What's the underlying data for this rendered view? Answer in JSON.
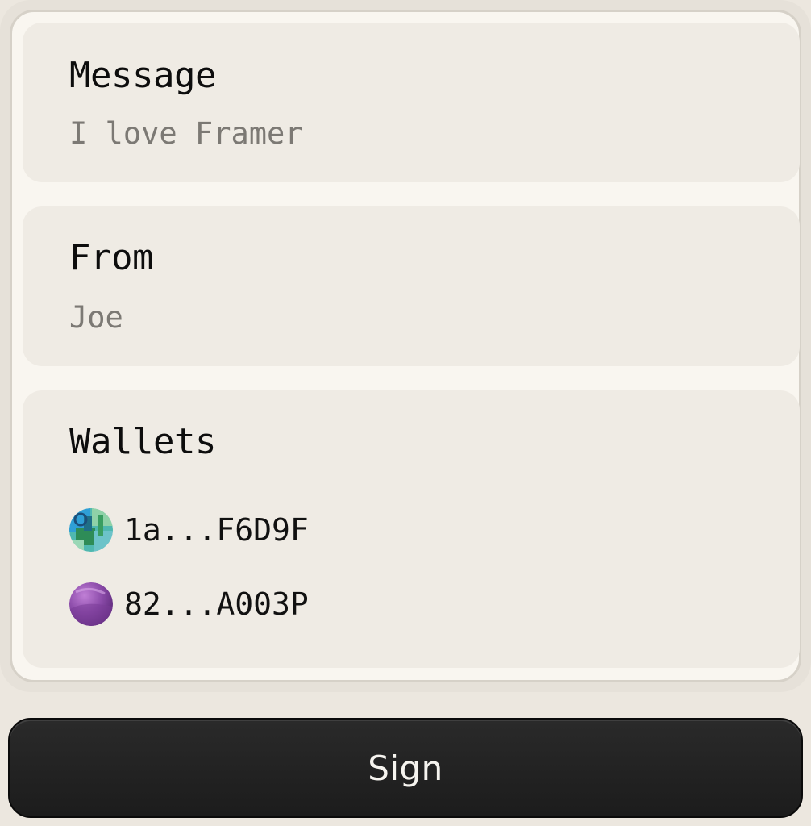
{
  "message": {
    "label": "Message",
    "value": "I love Framer"
  },
  "from": {
    "label": "From",
    "value": "Joe"
  },
  "wallets": {
    "label": "Wallets",
    "items": [
      {
        "address": "1a...F6D9F",
        "avatar_icon": "teal-wallet-avatar-icon"
      },
      {
        "address": "82...A003P",
        "avatar_icon": "purple-wallet-avatar-icon"
      }
    ]
  },
  "sign_button": {
    "label": "Sign"
  },
  "colors": {
    "background": "#ece7df",
    "card_inner": "#f9f6f0",
    "section": "#efebe4",
    "label_text": "#0d0d0d",
    "value_text": "#7c7974",
    "button_bg": "#1c1c1c",
    "button_text": "#f6f4ef"
  }
}
